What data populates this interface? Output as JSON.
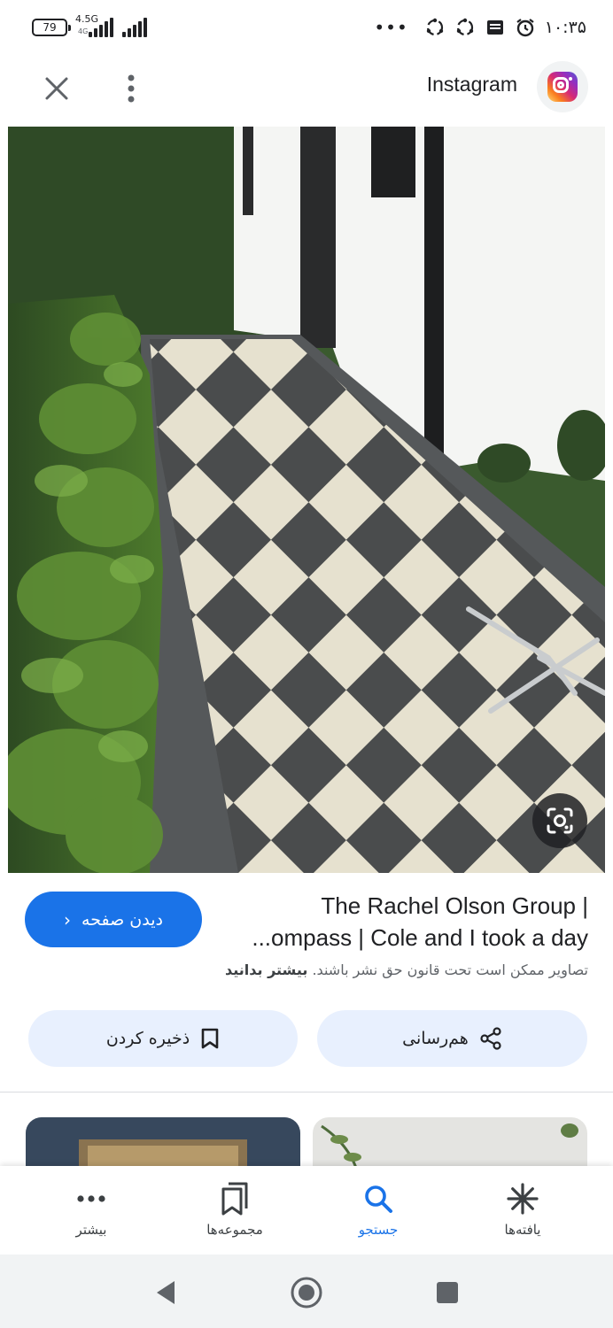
{
  "status_bar": {
    "battery_level": "79",
    "network_type": "4.5G",
    "network_sub": "4G",
    "overflow_dots": "•••",
    "time": "۱۰:۳۵"
  },
  "header": {
    "source_name": "Instagram",
    "icons": [
      "close-icon",
      "more-vert-icon",
      "instagram-logo"
    ]
  },
  "image": {
    "icons": [
      "lens-search-icon"
    ]
  },
  "result": {
    "title_line1": "The Rachel Olson Group |",
    "title_line2": "...ompass | Cole and I took a day",
    "visit_label": "دیدن صفحه",
    "visit_chevron": "‹",
    "copyright_text": "تصاویر ممکن است تحت قانون حق نشر باشند.",
    "learn_more": "بیشتر بدانید"
  },
  "actions": {
    "share_label": "هم‌رسانی",
    "save_label": "ذخیره کردن"
  },
  "bottom_nav": {
    "items": [
      {
        "label": "یافته‌ها",
        "icon": "asterisk-icon",
        "active": false
      },
      {
        "label": "جستجو",
        "icon": "search-icon",
        "active": true
      },
      {
        "label": "مجموعه‌ها",
        "icon": "collections-icon",
        "active": false
      },
      {
        "label": "بیشتر",
        "icon": "more-horiz-icon",
        "active": false
      }
    ]
  },
  "system_nav": {
    "icons": [
      "back-icon",
      "home-icon",
      "recents-icon"
    ]
  },
  "colors": {
    "accent": "#1a73e8",
    "chip_bg": "#e8f0fe",
    "text": "#202124",
    "secondary_text": "#5f6368"
  }
}
